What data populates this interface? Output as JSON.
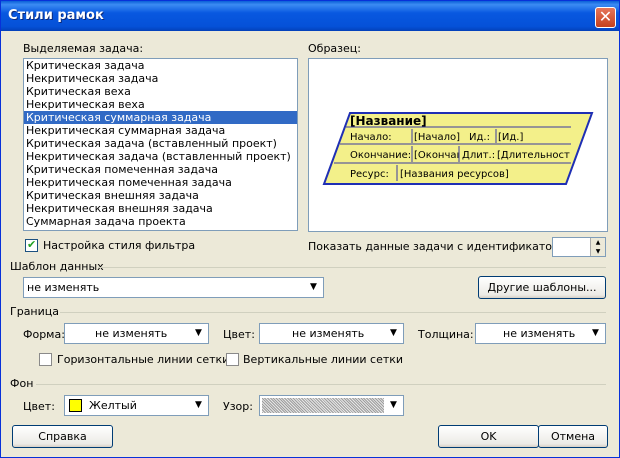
{
  "window": {
    "title": "Стили рамок",
    "close_symbol": "✕"
  },
  "task_list": {
    "label": "Выделяемая задача:",
    "items": [
      "Критическая задача",
      "Некритическая задача",
      "Критическая веха",
      "Некритическая веха",
      "Критическая суммарная задача",
      "Некритическая суммарная задача",
      "Критическая задача (вставленный проект)",
      "Некритическая задача (вставленный проект)",
      "Критическая помеченная задача",
      "Некритическая помеченная задача",
      "Критическая внешняя задача",
      "Некритическая внешняя задача",
      "Суммарная задача проекта"
    ],
    "selected_index": 4
  },
  "preview": {
    "label": "Образец:",
    "name": "[Название]",
    "row1_label": "Начало:",
    "row1_value": "[Начало]",
    "row1_label2": "Ид.:",
    "row1_value2": "[Ид.]",
    "row2_label": "Окончание:",
    "row2_value": "[Окончаı",
    "row2_label2": "Длит.:",
    "row2_value2": "[Длительност",
    "row3_label": "Ресурс:",
    "row3_value": "[Названия ресурсов]",
    "fill_color": "#f3f08a",
    "border_color": "#1f2fb4"
  },
  "filter_checkbox": {
    "label": "Настройка стиля фильтра",
    "checked": true
  },
  "show_data": {
    "label": "Показать данные задачи с идентификатором:",
    "value": ""
  },
  "data_template": {
    "group_label": "Шаблон данных",
    "value": "не изменять",
    "more_button": "Другие шаблоны..."
  },
  "border": {
    "group_label": "Граница",
    "shape_label": "Форма:",
    "shape_value": "не изменять",
    "color_label": "Цвет:",
    "color_value": "не изменять",
    "width_label": "Толщина:",
    "width_value": "не изменять",
    "hgrid_label": "Горизонтальные линии сетки",
    "vgrid_label": "Вертикальные линии сетки"
  },
  "background": {
    "group_label": "Фон",
    "color_label": "Цвет:",
    "color_value": "Желтый",
    "color_swatch": "#ffff00",
    "pattern_label": "Узор:"
  },
  "buttons": {
    "help": "Справка",
    "ok": "OK",
    "cancel": "Отмена"
  },
  "arrow_glyph": "▼",
  "spin_up": "▲",
  "spin_down": "▼"
}
